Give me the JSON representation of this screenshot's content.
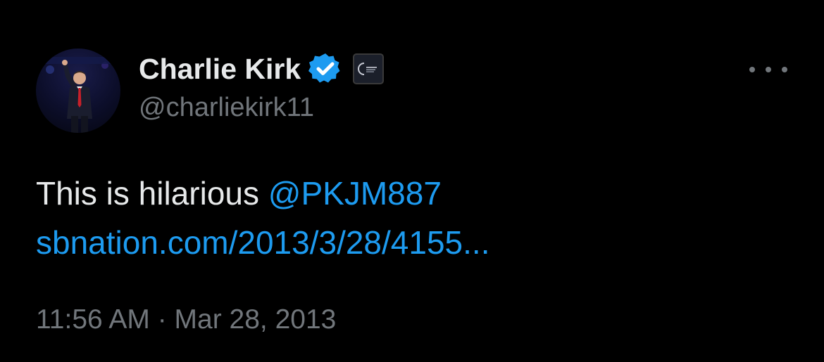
{
  "author": {
    "display_name": "Charlie Kirk",
    "handle": "@charliekirk11",
    "verified": true,
    "avatar_icon": "profile-photo-avatar",
    "affiliate_badge_icon": "affiliate-organization-badge"
  },
  "tweet": {
    "text": "This is hilarious ",
    "mention": "@PKJM887",
    "link": "sbnation.com/2013/3/28/4155...",
    "timestamp": "11:56 AM · Mar 28, 2013"
  },
  "menu": {
    "more_icon": "more-horizontal-icon"
  },
  "colors": {
    "background": "#000000",
    "primary_text": "#e7e9ea",
    "secondary_text": "#71767b",
    "link": "#1d9bf0",
    "verified_badge": "#1d9bf0"
  }
}
